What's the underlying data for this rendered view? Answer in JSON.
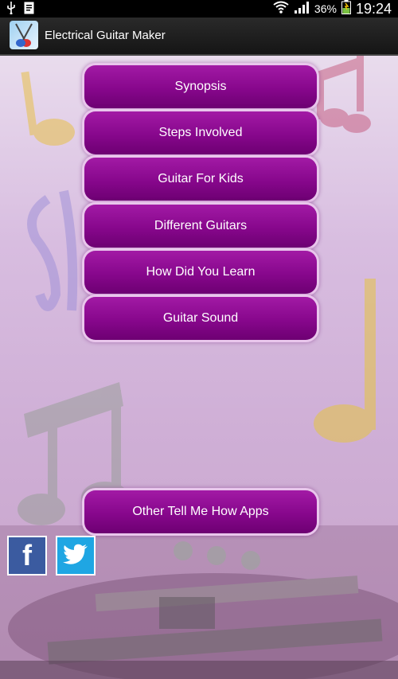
{
  "status_bar": {
    "battery": "36%",
    "time": "19:24"
  },
  "app": {
    "title": "Electrical Guitar Maker"
  },
  "menu": [
    {
      "label": "Synopsis"
    },
    {
      "label": "Steps Involved"
    },
    {
      "label": "Guitar For Kids"
    },
    {
      "label": "Different Guitars"
    },
    {
      "label": "How Did You Learn"
    },
    {
      "label": "Guitar Sound"
    }
  ],
  "other_apps_button": "Other Tell Me How Apps",
  "social": {
    "facebook_glyph": "f",
    "facebook_icon": "facebook-icon",
    "twitter_icon": "twitter-bird-icon"
  }
}
